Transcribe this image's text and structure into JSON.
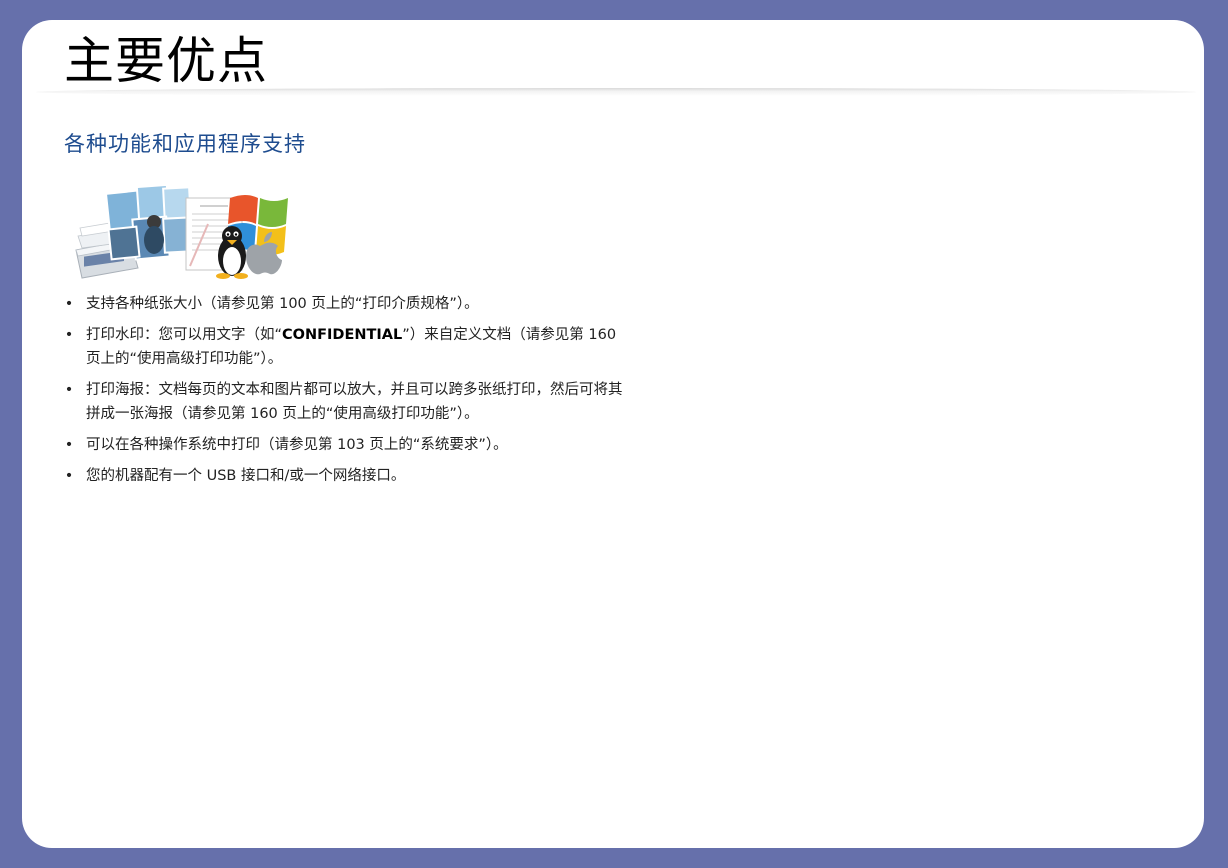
{
  "page": {
    "title": "主要优点",
    "section_heading": "各种功能和应用程序支持"
  },
  "hero": {
    "icons": [
      "photo-collage-icon",
      "printer-icon",
      "document-icon",
      "windows-logo-icon",
      "linux-penguin-icon",
      "apple-logo-icon"
    ]
  },
  "features": [
    {
      "bullet": "•",
      "text": "支持各种纸张大小（请参见第 100 页上的“打印介质规格”）。"
    },
    {
      "bullet": "•",
      "before": "打印水印：您可以用文字（如“",
      "emphasis": "CONFIDENTIAL",
      "after": "”）来自定义文档（请参见第 160 页上的“使用高级打印功能”）。"
    },
    {
      "bullet": "•",
      "text": "打印海报：文档每页的文本和图片都可以放大，并且可以跨多张纸打印，然后可将其拼成一张海报（请参见第 160 页上的“使用高级打印功能”）。"
    },
    {
      "bullet": "•",
      "text": "可以在各种操作系统中打印（请参见第 103 页上的“系统要求”）。"
    },
    {
      "bullet": "•",
      "text": "您的机器配有一个 USB 接口和/或一个网络接口。"
    }
  ]
}
